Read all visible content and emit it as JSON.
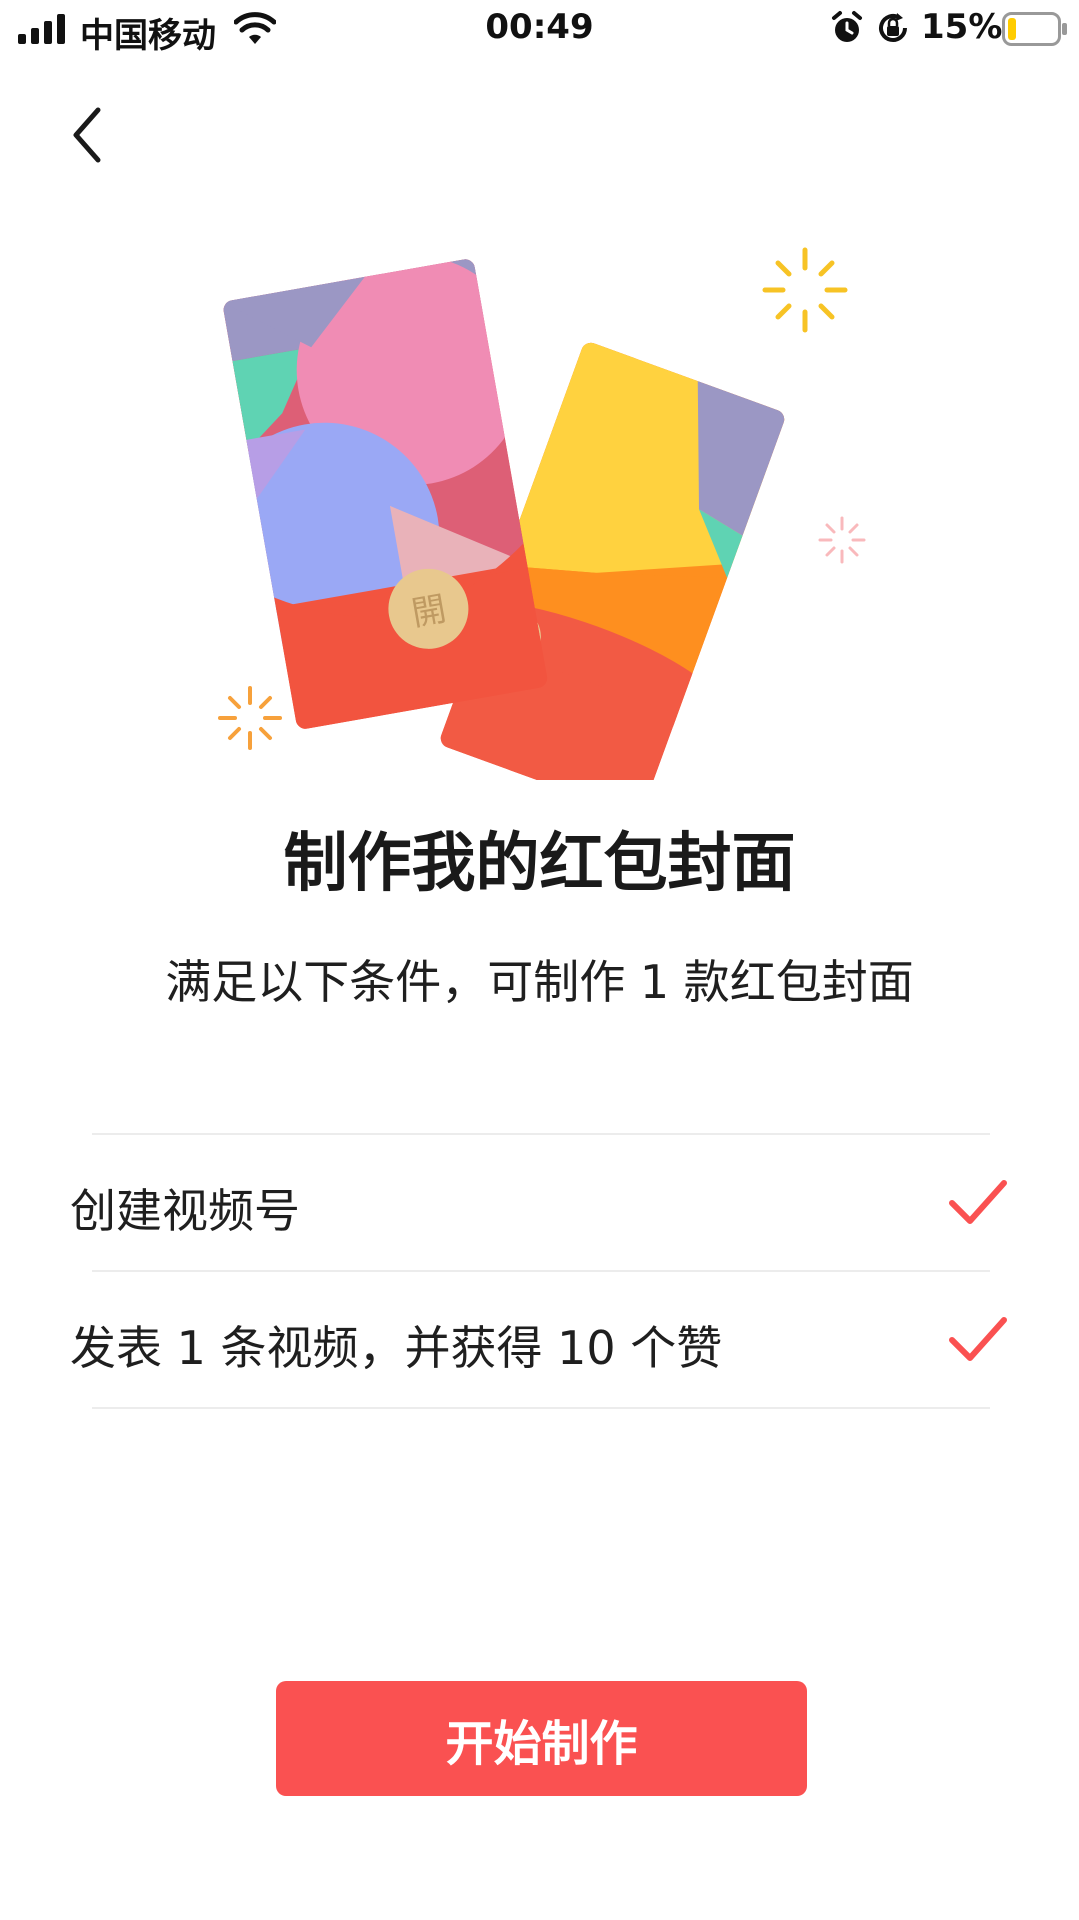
{
  "status_bar": {
    "carrier": "中国移动",
    "time": "00:49",
    "battery_percent": "15%",
    "battery_level": 0.15,
    "icons": [
      "signal-icon",
      "wifi-icon",
      "alarm-icon",
      "rotation-lock-icon",
      "battery-icon"
    ]
  },
  "nav": {
    "back_icon": "back-chevron-icon"
  },
  "illustration": {
    "open_char": "開",
    "colors": {
      "red": "#f25543",
      "gold": "#e8c88e",
      "accent": "#fa5151"
    }
  },
  "main": {
    "title": "制作我的红包封面",
    "subtitle": "满足以下条件，可制作 1 款红包封面"
  },
  "conditions": [
    {
      "label": "创建视频号",
      "done": true,
      "icon": "check-icon"
    },
    {
      "label": "发表 1 条视频，并获得 10 个赞",
      "done": true,
      "icon": "check-icon"
    }
  ],
  "action": {
    "start_label": "开始制作",
    "color": "#fa5151"
  }
}
